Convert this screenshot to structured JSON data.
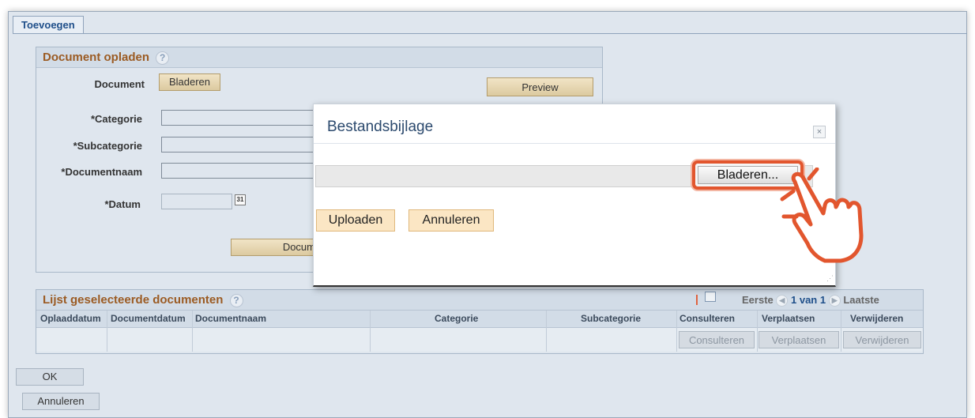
{
  "tab": {
    "label": "Toevoegen"
  },
  "upload_section": {
    "title": "Document opladen",
    "document_label": "Document",
    "browse_label": "Bladeren",
    "preview_label": "Preview",
    "category_label": "*Categorie",
    "subcategory_label": "*Subcategorie",
    "docname_label": "*Documentnaam",
    "date_label": "*Datum",
    "calendar_icon_text": "31",
    "doc_button_partial": "Docum"
  },
  "list_section": {
    "title": "Lijst geselecteerde documenten",
    "nav": {
      "first": "Eerste",
      "page": "1 van 1",
      "last": "Laatste"
    },
    "columns": [
      "Oplaaddatum",
      "Documentdatum",
      "Documentnaam",
      "Categorie",
      "Subcategorie",
      "Consulteren",
      "Verplaatsen",
      "Verwijderen"
    ],
    "row_buttons": [
      "Consulteren",
      "Verplaatsen",
      "Verwijderen"
    ]
  },
  "footer": {
    "ok_label": "OK",
    "cancel_label": "Annuleren"
  },
  "dialog": {
    "title": "Bestandsbijlage",
    "close_symbol": "×",
    "browse_label": "Bladeren...",
    "upload_label": "Uploaden",
    "cancel_label": "Annuleren"
  },
  "colors": {
    "accent": "#e2562e",
    "section_title": "#9b5b23",
    "tab_text": "#1f4f8a"
  },
  "icons": [
    "help-icon",
    "calendar-icon",
    "popout-icon",
    "nav-prev-icon",
    "nav-next-icon",
    "close-icon",
    "hand-pointer-icon",
    "resize-grip-icon"
  ]
}
